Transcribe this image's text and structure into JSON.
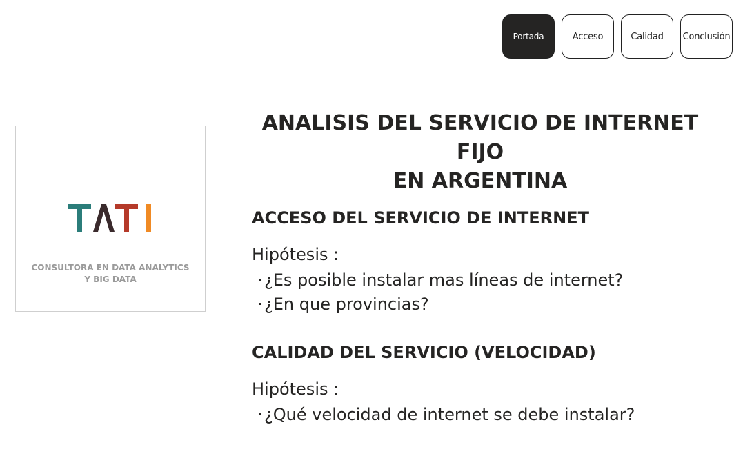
{
  "nav": {
    "buttons": [
      {
        "label": "Portada",
        "active": true
      },
      {
        "label": "Acceso",
        "active": false
      },
      {
        "label": "Calidad",
        "active": false
      },
      {
        "label": "Conclusión",
        "active": false
      }
    ]
  },
  "logo": {
    "wordmark": "TATI",
    "tagline_line1": "CONSULTORA EN DATA ANALYTICS",
    "tagline_line2": "Y BIG DATA",
    "colors": {
      "t1": "#2b7d7a",
      "a": "#3a2a2c",
      "t2": "#b53a2a",
      "i": "#f08a24"
    }
  },
  "main": {
    "title_line1": "ANALISIS DEL SERVICIO DE INTERNET FIJO",
    "title_line2": "EN ARGENTINA",
    "sections": [
      {
        "heading": "ACCESO DEL SERVICIO DE INTERNET",
        "hypothesis_label": "Hipótesis :",
        "questions": [
          "¿Es posible instalar mas líneas de internet?",
          "¿En que provincias?"
        ]
      },
      {
        "heading": "CALIDAD DEL SERVICIO (VELOCIDAD)",
        "hypothesis_label": "Hipótesis :",
        "questions": [
          "¿Qué velocidad de internet se debe instalar?"
        ]
      }
    ]
  }
}
